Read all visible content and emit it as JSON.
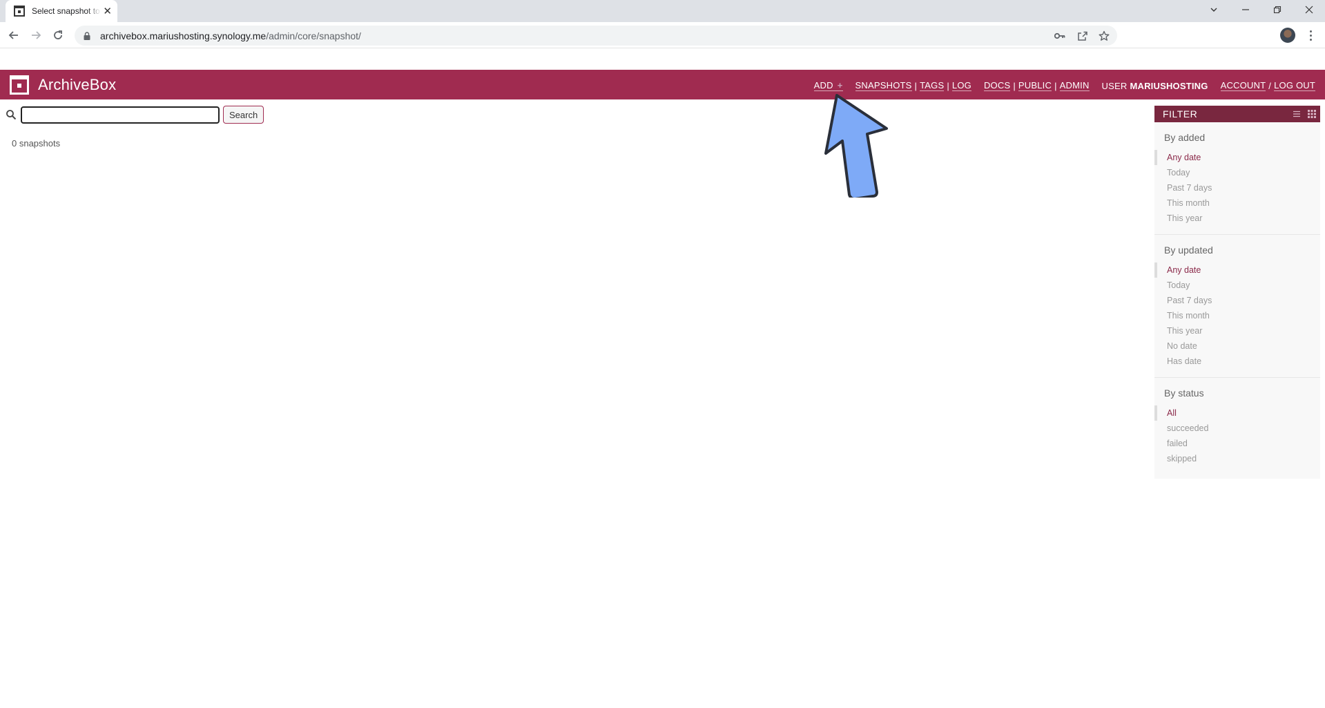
{
  "browser": {
    "tab_title": "Select snapshot to change",
    "url_host": "archivebox.mariushosting.synology.me",
    "url_path": "/admin/core/snapshot/"
  },
  "header": {
    "brand": "ArchiveBox",
    "nav": {
      "add": "ADD",
      "add_plus": "+",
      "snapshots": "SNAPSHOTS",
      "tags": "TAGS",
      "log": "LOG",
      "docs": "DOCS",
      "public": "PUBLIC",
      "admin": "ADMIN",
      "user_prefix": "USER",
      "username": "MARIUSHOSTING",
      "account": "ACCOUNT",
      "logout": "LOG OUT",
      "pipe": "|",
      "slash": "/"
    }
  },
  "search": {
    "value": "",
    "button_label": "Search"
  },
  "result_count": "0 snapshots",
  "filter": {
    "title": "FILTER",
    "groups": [
      {
        "title": "By added",
        "items": [
          "Any date",
          "Today",
          "Past 7 days",
          "This month",
          "This year"
        ],
        "selected": 0
      },
      {
        "title": "By updated",
        "items": [
          "Any date",
          "Today",
          "Past 7 days",
          "This month",
          "This year",
          "No date",
          "Has date"
        ],
        "selected": 0
      },
      {
        "title": "By status",
        "items": [
          "All",
          "succeeded",
          "failed",
          "skipped"
        ],
        "selected": 0
      }
    ]
  },
  "colors": {
    "header": "#a02b50",
    "filter_header": "#79273f",
    "arrow_fill": "#7eaaf7"
  }
}
